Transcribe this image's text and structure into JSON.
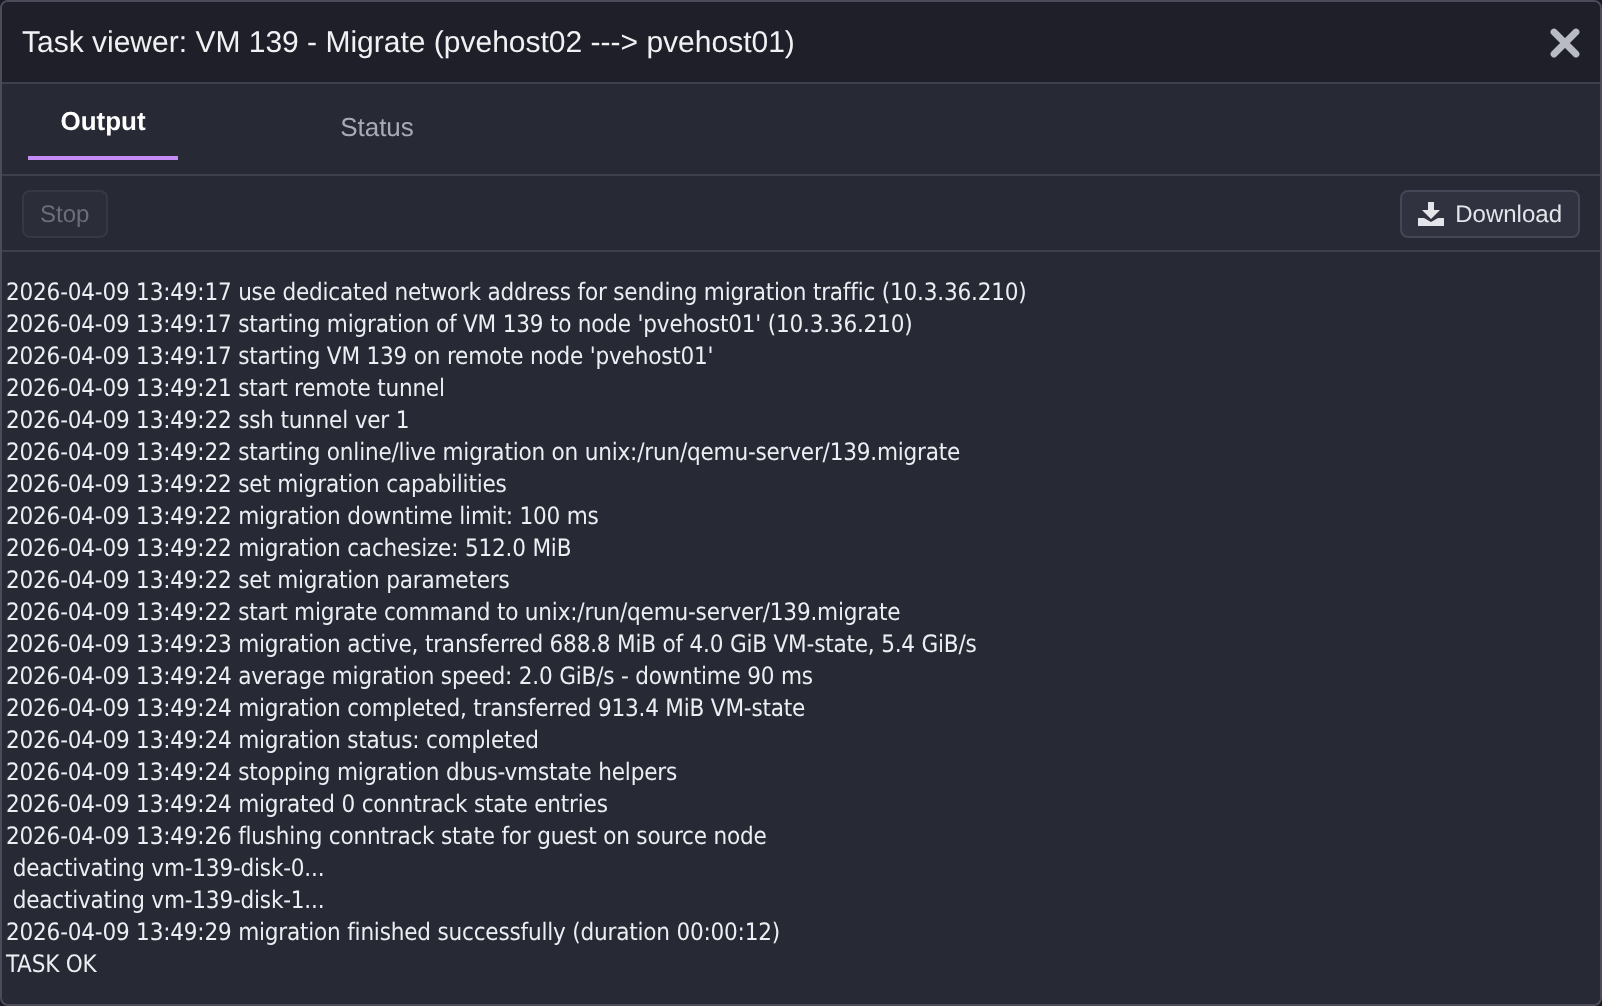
{
  "window": {
    "title": "Task viewer: VM 139 - Migrate (pvehost02 ---> pvehost01)"
  },
  "tabs": [
    {
      "label": "Output",
      "selected": true
    },
    {
      "label": "Status",
      "selected": false
    }
  ],
  "toolbar": {
    "stop": {
      "label": "Stop",
      "disabled": true
    },
    "download": {
      "label": "Download"
    }
  },
  "log": [
    "2026-04-09 13:49:17 use dedicated network address for sending migration traffic (10.3.36.210)",
    "2026-04-09 13:49:17 starting migration of VM 139 to node 'pvehost01' (10.3.36.210)",
    "2026-04-09 13:49:17 starting VM 139 on remote node 'pvehost01'",
    "2026-04-09 13:49:21 start remote tunnel",
    "2026-04-09 13:49:22 ssh tunnel ver 1",
    "2026-04-09 13:49:22 starting online/live migration on unix:/run/qemu-server/139.migrate",
    "2026-04-09 13:49:22 set migration capabilities",
    "2026-04-09 13:49:22 migration downtime limit: 100 ms",
    "2026-04-09 13:49:22 migration cachesize: 512.0 MiB",
    "2026-04-09 13:49:22 set migration parameters",
    "2026-04-09 13:49:22 start migrate command to unix:/run/qemu-server/139.migrate",
    "2026-04-09 13:49:23 migration active, transferred 688.8 MiB of 4.0 GiB VM-state, 5.4 GiB/s",
    "2026-04-09 13:49:24 average migration speed: 2.0 GiB/s - downtime 90 ms",
    "2026-04-09 13:49:24 migration completed, transferred 913.4 MiB VM-state",
    "2026-04-09 13:49:24 migration status: completed",
    "2026-04-09 13:49:24 stopping migration dbus-vmstate helpers",
    "2026-04-09 13:49:24 migrated 0 conntrack state entries",
    "2026-04-09 13:49:26 flushing conntrack state for guest on source node",
    " deactivating vm-139-disk-0...",
    " deactivating vm-139-disk-1...",
    "2026-04-09 13:49:29 migration finished successfully (duration 00:00:12)",
    "TASK OK"
  ]
}
